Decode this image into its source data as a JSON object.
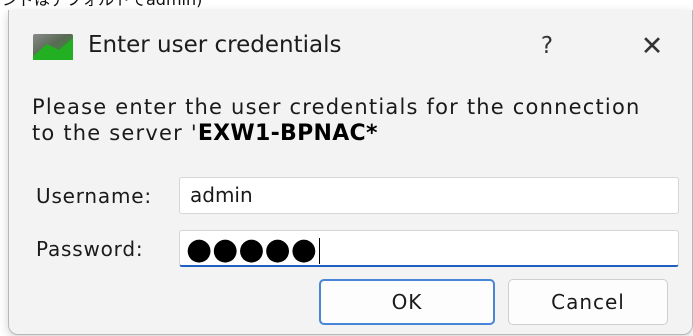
{
  "background_text": "ンドはデフォルトでadmin)",
  "dialog": {
    "title": "Enter user credentials",
    "help_label": "?",
    "close_label": "✕",
    "icon": "app-green-flag-icon",
    "message_line1": "Please enter the user credentials for the connection",
    "message_line2_prefix": "to the server '",
    "server_name": "EXW1-BPNAC*",
    "username_label": "Username:",
    "username_value": "admin",
    "password_label": "Password:",
    "password_mask": "●●●●●",
    "ok_label": "OK",
    "cancel_label": "Cancel"
  },
  "colors": {
    "focus_accent": "#1f5fbf",
    "ok_border": "#4a86d8",
    "dialog_bg": "#f3f3f3"
  }
}
